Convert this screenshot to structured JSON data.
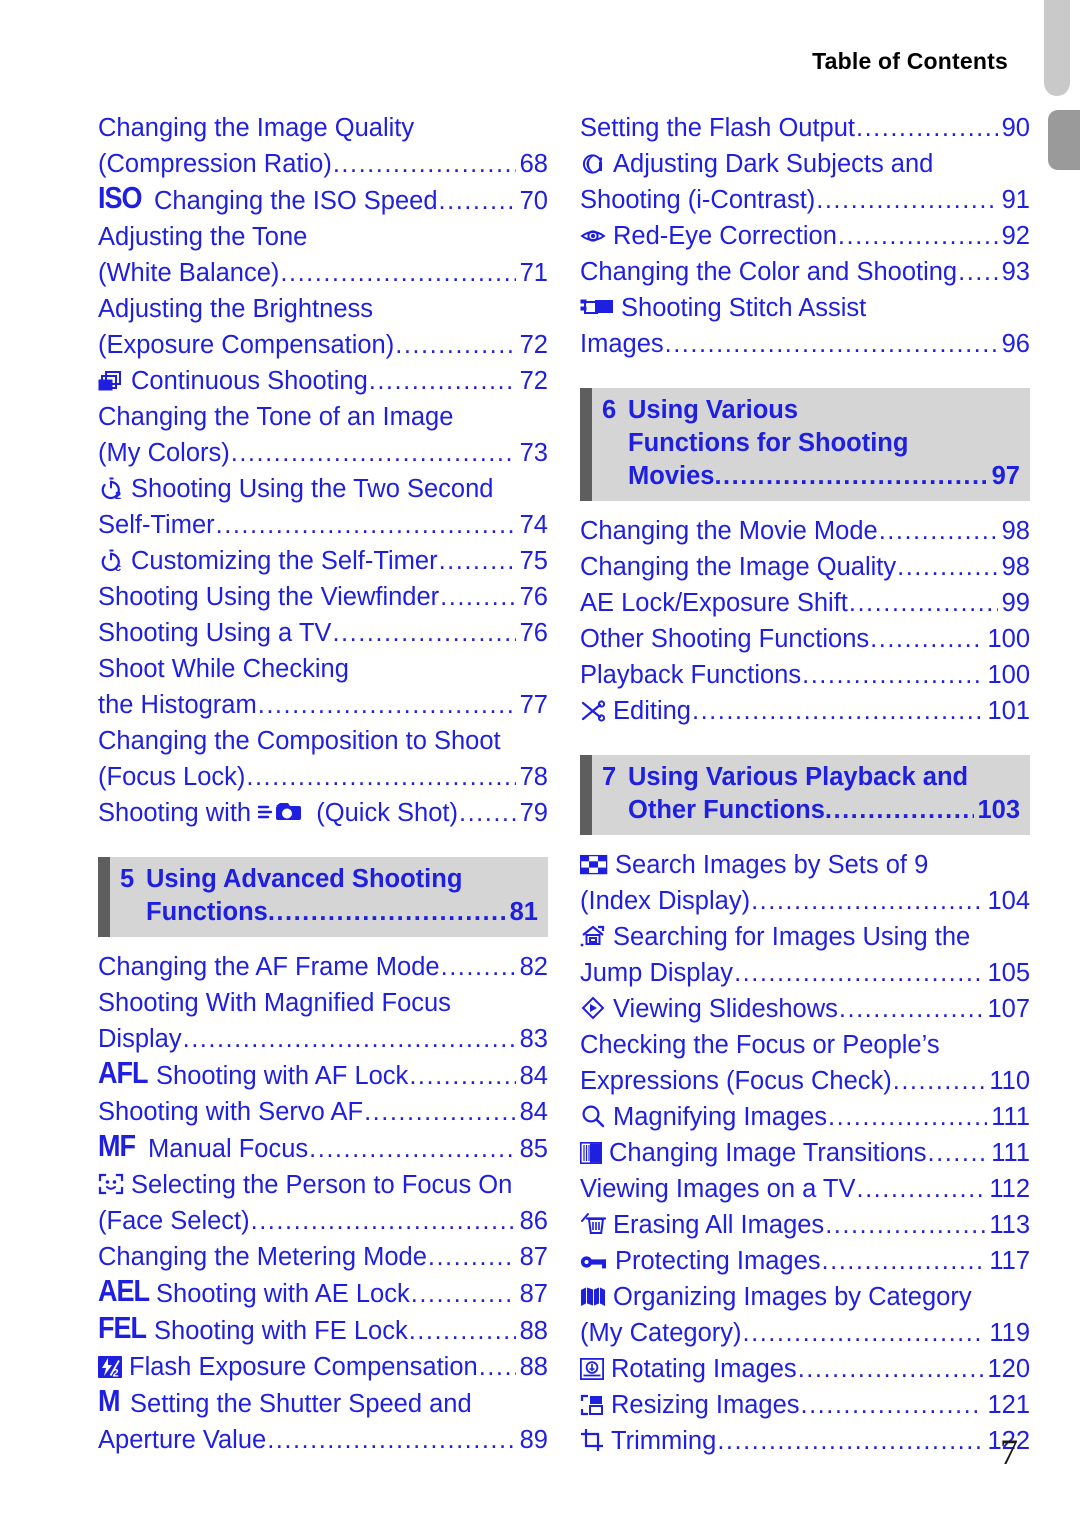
{
  "running_head": "Table of Contents",
  "folio": "7",
  "colors": {
    "link_blue": "#1f1fe0",
    "chapter_band": "#d5d5d5",
    "chapter_bar": "#5e5e5e",
    "tab_light": "#c9c9c9",
    "tab_dark": "#9a9a9a"
  },
  "left_column": [
    {
      "kind": "entry",
      "icon": null,
      "text": "Changing the Image Quality",
      "page": "",
      "leader": false
    },
    {
      "kind": "entry",
      "icon": null,
      "text": "(Compression Ratio)",
      "page": "68",
      "leader": true
    },
    {
      "kind": "entry",
      "icon": "iso-icon",
      "icon_text": "ISO",
      "text": "Changing the ISO Speed",
      "page": "70",
      "leader": true
    },
    {
      "kind": "entry",
      "icon": null,
      "text": "Adjusting the Tone",
      "page": "",
      "leader": false
    },
    {
      "kind": "entry",
      "icon": null,
      "text": "(White Balance)",
      "page": "71",
      "leader": true
    },
    {
      "kind": "entry",
      "icon": null,
      "text": "Adjusting the Brightness",
      "page": "",
      "leader": false
    },
    {
      "kind": "entry",
      "icon": null,
      "text": "(Exposure Compensation)",
      "page": "72",
      "leader": true
    },
    {
      "kind": "entry",
      "icon": "continuous-shooting-icon",
      "text": "Continuous Shooting",
      "page": "72",
      "leader": true
    },
    {
      "kind": "entry",
      "icon": null,
      "text": "Changing the Tone of an Image",
      "page": "",
      "leader": false
    },
    {
      "kind": "entry",
      "icon": null,
      "text": "(My Colors)",
      "page": "73",
      "leader": true
    },
    {
      "kind": "entry",
      "icon": "self-timer-2sec-icon",
      "text": "Shooting Using the Two Second",
      "page": "",
      "leader": false
    },
    {
      "kind": "entry",
      "icon": null,
      "text": "Self-Timer",
      "page": "74",
      "leader": true
    },
    {
      "kind": "entry",
      "icon": "self-timer-custom-icon",
      "text": "Customizing the Self-Timer",
      "page": "75",
      "leader": true
    },
    {
      "kind": "entry",
      "icon": null,
      "text": "Shooting Using the Viewfinder",
      "page": "76",
      "leader": true
    },
    {
      "kind": "entry",
      "icon": null,
      "text": "Shooting Using a TV",
      "page": "76",
      "leader": true
    },
    {
      "kind": "entry",
      "icon": null,
      "text": "Shoot While Checking",
      "page": "",
      "leader": false
    },
    {
      "kind": "entry",
      "icon": null,
      "text": "the Histogram",
      "page": "77",
      "leader": true
    },
    {
      "kind": "entry",
      "icon": null,
      "text": "Changing the Composition to Shoot",
      "page": "",
      "leader": false
    },
    {
      "kind": "entry",
      "icon": null,
      "text": "(Focus Lock)",
      "page": "78",
      "leader": true
    },
    {
      "kind": "entry-quickshot",
      "icon": "quick-shot-camera-icon",
      "text_before": "Shooting with",
      "text_after": "(Quick Shot)",
      "page": "79",
      "leader": true
    },
    {
      "kind": "gap"
    },
    {
      "kind": "chapter",
      "number": "5",
      "lines": [
        {
          "text": "Using Advanced Shooting",
          "page": "",
          "leader": false
        },
        {
          "text": "Functions",
          "page": "81",
          "leader": true
        }
      ]
    },
    {
      "kind": "entry",
      "icon": null,
      "text": "Changing the AF Frame Mode",
      "page": "82",
      "leader": true
    },
    {
      "kind": "entry",
      "icon": null,
      "text": "Shooting With Magnified Focus",
      "page": "",
      "leader": false
    },
    {
      "kind": "entry",
      "icon": null,
      "text": "Display",
      "page": "83",
      "leader": true
    },
    {
      "kind": "entry",
      "icon": "af-lock-icon",
      "icon_text": "AFL",
      "text": "Shooting with AF Lock",
      "page": "84",
      "leader": true
    },
    {
      "kind": "entry",
      "icon": null,
      "text": "Shooting with Servo AF",
      "page": "84",
      "leader": true
    },
    {
      "kind": "entry",
      "icon": "manual-focus-icon",
      "icon_text": "MF",
      "text": "Manual Focus",
      "page": "85",
      "leader": true
    },
    {
      "kind": "entry",
      "icon": "face-select-icon",
      "text": "Selecting the Person to Focus On",
      "page": "",
      "leader": false
    },
    {
      "kind": "entry",
      "icon": null,
      "text": "(Face Select)",
      "page": "86",
      "leader": true
    },
    {
      "kind": "entry",
      "icon": null,
      "text": "Changing the Metering Mode",
      "page": "87",
      "leader": true
    },
    {
      "kind": "entry",
      "icon": "ae-lock-icon",
      "icon_text": "AEL",
      "text": "Shooting with AE Lock",
      "page": "87",
      "leader": true
    },
    {
      "kind": "entry",
      "icon": "fe-lock-icon",
      "icon_text": "FEL",
      "text": "Shooting with FE Lock",
      "page": "88",
      "leader": true
    },
    {
      "kind": "entry",
      "icon": "flash-exposure-comp-icon",
      "text": "Flash Exposure Compensation",
      "page": "88",
      "leader": true
    },
    {
      "kind": "entry",
      "icon": "manual-mode-icon",
      "icon_text": "M",
      "text": "Setting the Shutter Speed and",
      "page": "",
      "leader": false
    },
    {
      "kind": "entry",
      "icon": null,
      "text": "Aperture Value",
      "page": "89",
      "leader": true
    }
  ],
  "right_column": [
    {
      "kind": "entry",
      "icon": null,
      "text": "Setting the Flash Output",
      "page": "90",
      "leader": true
    },
    {
      "kind": "entry",
      "icon": "i-contrast-icon",
      "text": "Adjusting Dark Subjects and",
      "page": "",
      "leader": false
    },
    {
      "kind": "entry",
      "icon": null,
      "text": "Shooting (i-Contrast)",
      "page": "91",
      "leader": true
    },
    {
      "kind": "entry",
      "icon": "red-eye-correction-icon",
      "text": "Red-Eye Correction",
      "page": "92",
      "leader": true
    },
    {
      "kind": "entry",
      "icon": null,
      "text": "Changing the Color and Shooting",
      "page": "93",
      "leader": true
    },
    {
      "kind": "entry",
      "icon": "stitch-assist-icon",
      "text": "Shooting Stitch Assist",
      "page": "",
      "leader": false
    },
    {
      "kind": "entry",
      "icon": null,
      "text": "Images",
      "page": "96",
      "leader": true
    },
    {
      "kind": "gap"
    },
    {
      "kind": "chapter",
      "number": "6",
      "lines": [
        {
          "text": "Using Various",
          "page": "",
          "leader": false
        },
        {
          "text": "Functions for Shooting",
          "page": "",
          "leader": false
        },
        {
          "text": "Movies",
          "page": "97",
          "leader": true
        }
      ]
    },
    {
      "kind": "entry",
      "icon": null,
      "text": "Changing the Movie Mode",
      "page": "98",
      "leader": true
    },
    {
      "kind": "entry",
      "icon": null,
      "text": "Changing the Image Quality",
      "page": "98",
      "leader": true
    },
    {
      "kind": "entry",
      "icon": null,
      "text": "AE Lock/Exposure Shift",
      "page": "99",
      "leader": true
    },
    {
      "kind": "entry",
      "icon": null,
      "text": "Other Shooting Functions",
      "page": "100",
      "leader": true
    },
    {
      "kind": "entry",
      "icon": null,
      "text": "Playback Functions",
      "page": "100",
      "leader": true
    },
    {
      "kind": "entry",
      "icon": "editing-scissors-icon",
      "text": "Editing",
      "page": "101",
      "leader": true
    },
    {
      "kind": "gap"
    },
    {
      "kind": "chapter",
      "number": "7",
      "lines": [
        {
          "text": "Using Various Playback and",
          "page": "",
          "leader": false
        },
        {
          "text": "Other Functions",
          "page": "103",
          "leader": true
        }
      ]
    },
    {
      "kind": "entry",
      "icon": "index-display-icon",
      "text": "Search Images by Sets of 9",
      "page": "",
      "leader": false
    },
    {
      "kind": "entry",
      "icon": null,
      "text": "(Index Display)",
      "page": "104",
      "leader": true
    },
    {
      "kind": "entry",
      "icon": "jump-display-icon",
      "text": "Searching for Images Using the",
      "page": "",
      "leader": false
    },
    {
      "kind": "entry",
      "icon": null,
      "text": "Jump Display",
      "page": "105",
      "leader": true
    },
    {
      "kind": "entry",
      "icon": "slideshow-icon",
      "text": "Viewing Slideshows",
      "page": "107",
      "leader": true
    },
    {
      "kind": "entry",
      "icon": null,
      "text": "Checking the Focus or People’s",
      "page": "",
      "leader": false
    },
    {
      "kind": "entry",
      "icon": null,
      "text": "Expressions (Focus Check)",
      "page": "110",
      "leader": true
    },
    {
      "kind": "entry",
      "icon": "magnify-icon",
      "text": "Magnifying Images",
      "page": "111",
      "leader": true
    },
    {
      "kind": "entry",
      "icon": "image-transition-icon",
      "text": "Changing Image Transitions",
      "page": "111",
      "leader": true
    },
    {
      "kind": "entry",
      "icon": null,
      "text": "Viewing Images on a TV",
      "page": "112",
      "leader": true
    },
    {
      "kind": "entry",
      "icon": "erase-all-icon",
      "text": "Erasing All Images",
      "page": "113",
      "leader": true
    },
    {
      "kind": "entry",
      "icon": "protect-images-icon",
      "text": "Protecting Images",
      "page": "117",
      "leader": true
    },
    {
      "kind": "entry",
      "icon": "my-category-icon",
      "text": "Organizing Images by Category",
      "page": "",
      "leader": false
    },
    {
      "kind": "entry",
      "icon": null,
      "text": "(My Category)",
      "page": "119",
      "leader": true
    },
    {
      "kind": "entry",
      "icon": "rotate-images-icon",
      "text": "Rotating Images",
      "page": "120",
      "leader": true
    },
    {
      "kind": "entry",
      "icon": "resize-images-icon",
      "text": "Resizing Images",
      "page": "121",
      "leader": true
    },
    {
      "kind": "entry",
      "icon": "trimming-icon",
      "text": "Trimming",
      "page": "122",
      "leader": true
    }
  ]
}
